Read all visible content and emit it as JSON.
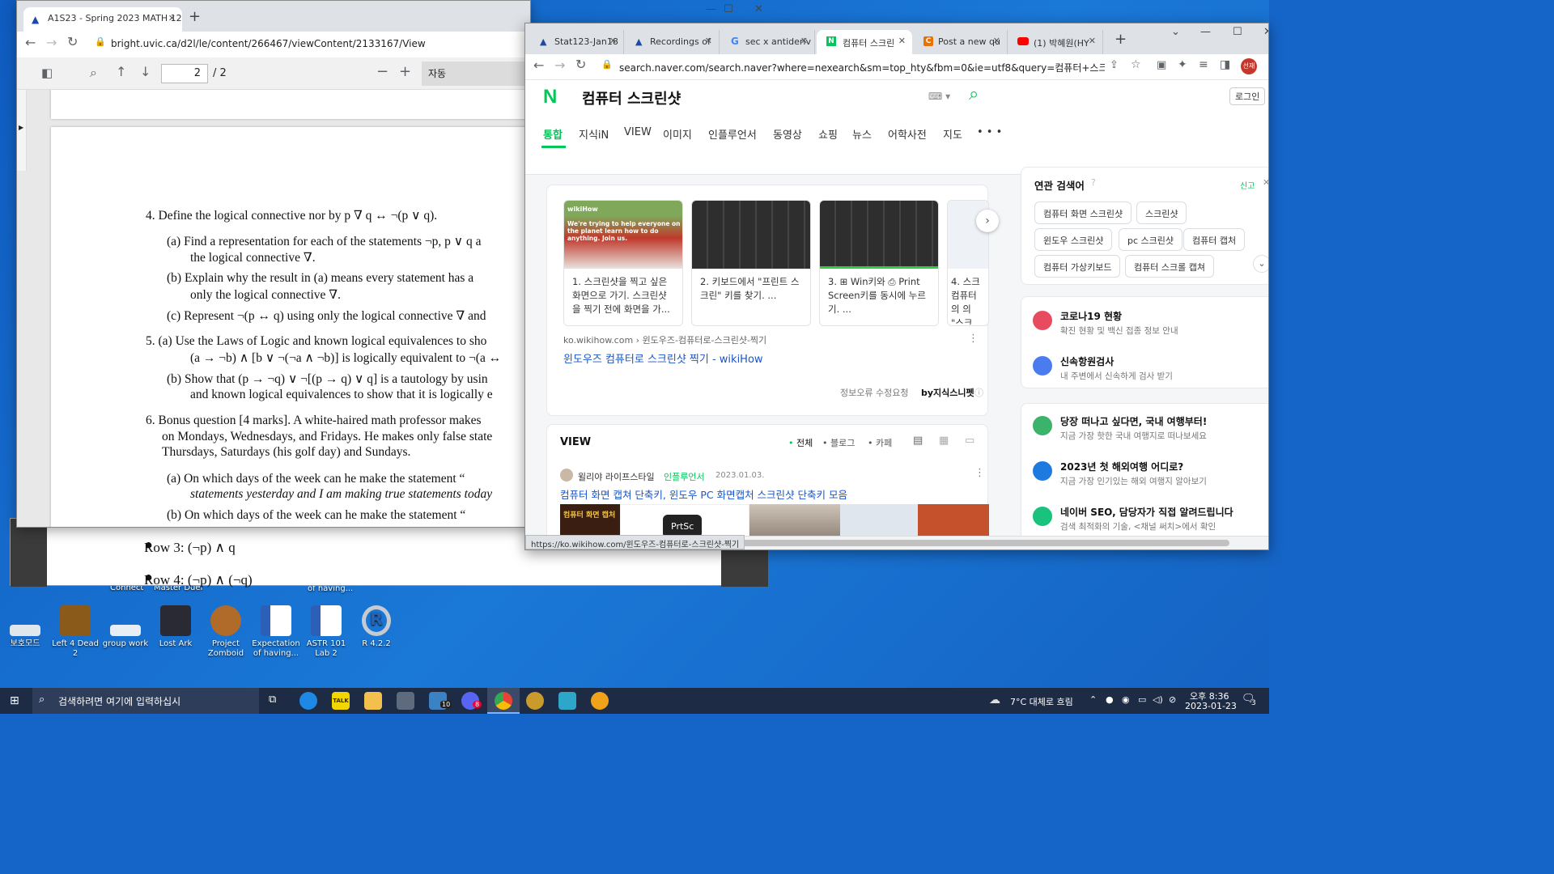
{
  "desktop": {
    "icons": [
      {
        "label": "보호모드",
        "color": "#dfe6ee"
      },
      {
        "label": "Left 4 Dead 2",
        "color": "#8a5a1a"
      },
      {
        "label": "group work",
        "color": "#e8eef6"
      },
      {
        "label": "Lost Ark",
        "color": "#2a2a34"
      },
      {
        "label": "Project Zomboid",
        "color": "#b06a2a"
      },
      {
        "label": "Expectation of having...",
        "color": "#2b5fb8"
      },
      {
        "label": "ASTR 101 Lab 2",
        "color": "#2b5fb8"
      },
      {
        "label": "R 4.2.2",
        "color": "#3a6ab0"
      }
    ],
    "top_fragments": [
      "Connect",
      "Master Duel",
      "of having..."
    ]
  },
  "pdf_window": {
    "tab_title": "A1S23 - Spring 2023 MATH 12",
    "url": "bright.uvic.ca/d2l/le/content/266467/viewContent/2133167/View",
    "page_input": "2",
    "page_total": "/ 2",
    "zoom": "자동",
    "lines": [
      "4.  Define the logical connective nor by    p ∇ q    ↔   ¬(p ∨ q).",
      "(a)  Find a representation for each of the statements ¬p, p ∨ q a",
      "the logical connective  ∇.",
      "(b)  Explain why the result in (a) means every statement has a",
      "only the logical connective  ∇.",
      "(c)  Represent ¬(p ↔ q) using only the logical connective  ∇  and",
      "5.   (a)  Use the Laws of Logic and known logical equivalences to sho",
      "(a → ¬b) ∧ [b ∨ ¬(¬a ∧ ¬b)] is logically equivalent to ¬(a ↔",
      "(b)  Show that (p → ¬q) ∨ ¬[(p → q) ∨ q] is a tautology by usin",
      "and known logical equivalences to show that it is logically e",
      "6.  Bonus question [4 marks]. A white-haired math professor makes",
      "on Mondays, Wednesdays, and Fridays. He makes only false state",
      "Thursdays, Saturdays (his golf day) and Sundays.",
      "(a)  On which days of the week can he make the statement “",
      "statements yesterday and I am making true statements today",
      "(b)  On which days of the week can he make the statement “"
    ]
  },
  "back_doc": {
    "row3": "Row 3:  (¬p) ∧ q",
    "row4": "Row 4:  (¬p) ∧ (¬q)"
  },
  "naver_window": {
    "tabs": [
      "Stat123-Jan18",
      "Recordings of",
      "sec x antideriv",
      "컴퓨터 스크린",
      "Post a new qu",
      "(1) 박혜원(HY"
    ],
    "url": "search.naver.com/search.naver?where=nexearch&sm=top_hty&fbm=0&ie=utf8&query=컴퓨터+스크린샷",
    "avatar": "선재",
    "logo": "N",
    "query": "컴퓨터 스크린샷",
    "login": "로그인",
    "nav_tabs": [
      "통합",
      "지식iN",
      "VIEW",
      "이미지",
      "인플루언서",
      "동영상",
      "쇼핑",
      "뉴스",
      "어학사전",
      "지도",
      "• • •"
    ],
    "thumbs": [
      {
        "caption": "1.  스크린샷을 찍고 싶은 화면으로 가기. 스크린샷을 찍기 전에 화면을 가...",
        "overlay": "We're trying to help everyone on the planet learn how to do anything. Join us.",
        "brand": "wikiHow"
      },
      {
        "caption": "2.  키보드에서 \"프린트 스크린\" 키를 찾기. ..."
      },
      {
        "caption": "3.  ⊞ Win키와 ⎙ Print Screen키를 동시에 누르기. ..."
      },
      {
        "caption": "4.  스크 컴퓨터의 의 \"스크"
      }
    ],
    "source_site": "ko.wikihow.com",
    "source_path": "› 윈도우즈-컴퓨터로-스크린샷-찍기",
    "result_title": "윈도우즈 컴퓨터로 스크린샷 찍기 - wikiHow",
    "info_error": "정보오류 수정요청",
    "by_snippet": "by지식스니펫",
    "view_label": "VIEW",
    "view_filters": [
      "전체",
      "블로그",
      "카페"
    ],
    "post_author": "윌리야 라이프스타일",
    "post_badge": "인플루언서",
    "post_date": "2023.01.03.",
    "post_title": "컴퓨터 화면 캡쳐 단축키, 윈도우 PC 화면캡처 스크린샷 단축키 모음",
    "post_thumb_text": "컴퓨터 화면 캡처",
    "post_thumb_text2": "PrtSc",
    "status_url": "https://ko.wikihow.com/윈도우즈-컴퓨터로-스크린샷-찍기",
    "related_title": "연관 검색어",
    "related_report": "신고",
    "related": [
      "컴퓨터 화면 스크린샷",
      "스크린샷",
      "윈도우 스크린샷",
      "pc 스크린샷",
      "컴퓨터 캡처",
      "컴퓨터 가상키보드",
      "컴퓨터 스크롤 캡쳐"
    ],
    "side_items": [
      {
        "title": "코로나19 현황",
        "desc": "확진 현황 및 백신 접종 정보 안내",
        "color": "#e84a5f"
      },
      {
        "title": "신속항원검사",
        "desc": "내 주변에서 신속하게 검사 받기",
        "color": "#4a7cf0"
      },
      {
        "title": "당장 떠나고 싶다면, 국내 여행부터!",
        "desc": "지금 가장 핫한 국내 여행지로 떠나보세요",
        "color": "#3cb36a"
      },
      {
        "title": "2023년 첫 해외여행 어디로?",
        "desc": "지금 가장 인기있는 해외 여행지 알아보기",
        "color": "#1f7ae0"
      },
      {
        "title": "네이버 SEO, 담당자가 직접 알려드립니다",
        "desc": "검색 최적화의 기술, <채널 써치>에서 확인",
        "color": "#19c37d"
      }
    ]
  },
  "taskbar": {
    "search_placeholder": "검색하려면 여기에 입력하십시",
    "weather": "7°C  대체로 흐림",
    "time": "오후 8:36",
    "date": "2023-01-23",
    "notif": "3",
    "mail_badge": "10",
    "discord_badge": "8"
  },
  "colors": {
    "naver_green": "#03c75a",
    "chrome_tab": "#dee1e6",
    "link_blue": "#1a55c9"
  }
}
